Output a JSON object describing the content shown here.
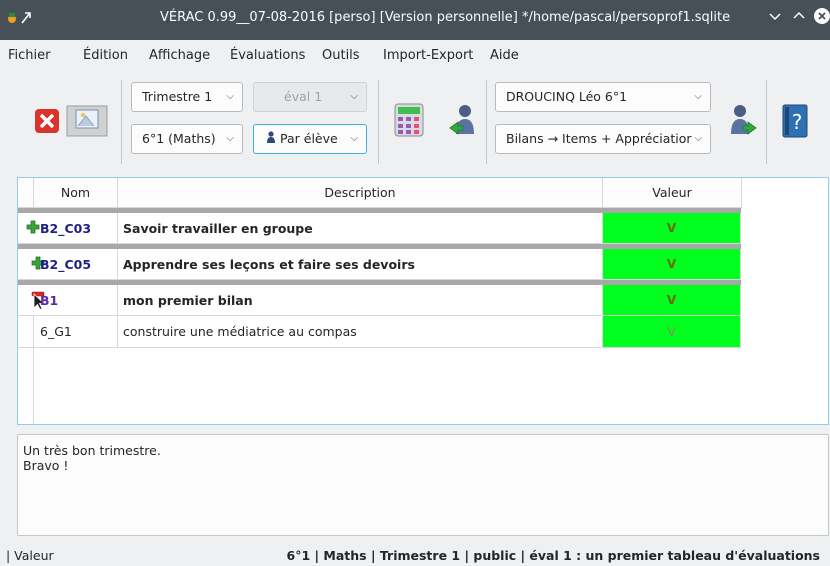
{
  "window": {
    "title": "VÉRAC 0.99__07-08-2016 [perso] [Version personnelle] */home/pascal/persoprof1.sqlite"
  },
  "menu": [
    "Fichier",
    "Édition",
    "Affichage",
    "Évaluations",
    "Outils",
    "Import-Export",
    "Aide"
  ],
  "toolbar": {
    "period": "Trimestre 1",
    "evaluation": "éval 1",
    "group": "6°1 (Maths)",
    "view_mode": "Par élève",
    "student": "DROUCINQ Léo 6°1",
    "display": "Bilans → Items + Appréciatior"
  },
  "table": {
    "headers": [
      "Nom",
      "Description",
      "Valeur"
    ],
    "rows": [
      {
        "code": "B2_C03",
        "description": "Savoir travailler en groupe",
        "value": "V",
        "kind": "group",
        "icon": "plus-icon"
      },
      {
        "code": "B2_C05",
        "description": "Apprendre ses leçons et faire ses devoirs",
        "value": "V",
        "kind": "group",
        "icon": "plus-icon"
      },
      {
        "code": "B1",
        "description": "mon premier bilan",
        "value": "V",
        "kind": "group-open",
        "icon": "minus-icon"
      },
      {
        "code": "6_G1",
        "description": "construire une médiatrice au compas",
        "value": "V",
        "kind": "item",
        "icon": ""
      }
    ]
  },
  "notes": {
    "line1": "Un très bon trimestre.",
    "line2": "Bravo !"
  },
  "status": {
    "left": "| Valeur",
    "right": "6°1 | Maths | Trimestre 1 | public | éval 1 : un premier tableau d'évaluations"
  },
  "colors": {
    "value_green": "#00ff1e",
    "titlebar": "#475057",
    "code_blue": "#1f1f8a",
    "table_border": "#93cee9"
  }
}
